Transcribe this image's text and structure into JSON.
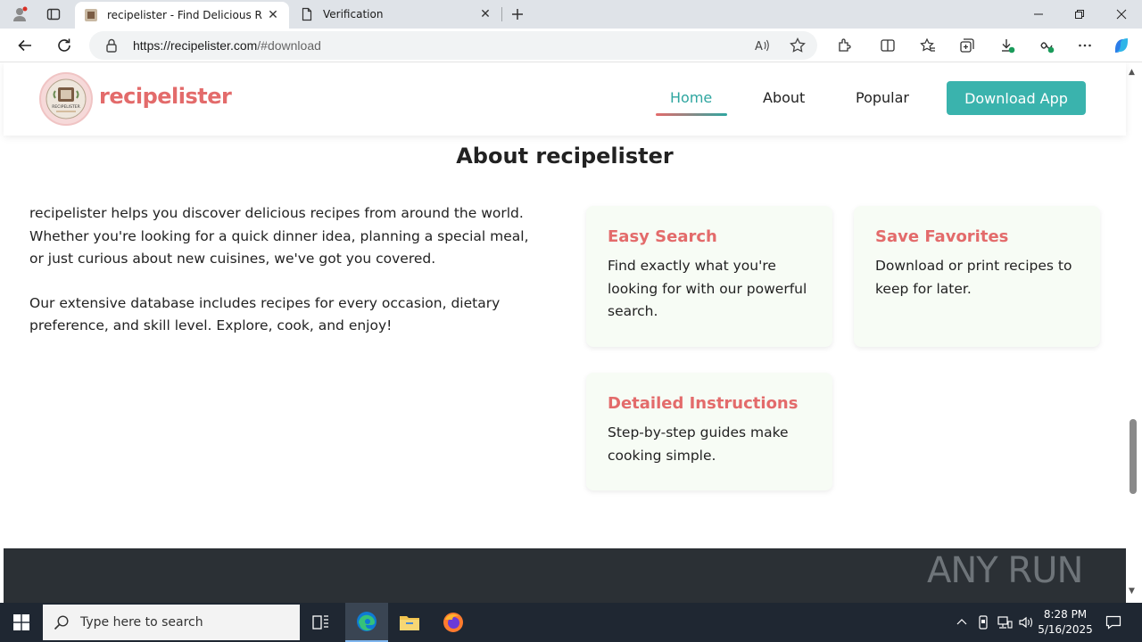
{
  "browser": {
    "tabs": [
      {
        "title": "recipelister - Find Delicious Recip",
        "active": true
      },
      {
        "title": "Verification",
        "active": false
      }
    ],
    "url_host": "https://recipelister.com",
    "url_path": "/#download",
    "icons": [
      "profile-icon",
      "tab-actions-icon",
      "new-tab-icon",
      "minimize-icon",
      "restore-icon",
      "close-window-icon",
      "back-icon",
      "refresh-icon",
      "lock-icon",
      "read-aloud-icon",
      "favorite-star-icon",
      "extensions-icon",
      "split-screen-icon",
      "favorites-icon",
      "collections-icon",
      "downloads-icon",
      "browser-essentials-icon",
      "more-icon",
      "copilot-icon"
    ]
  },
  "site": {
    "brand": "recipelister",
    "logo_text": "RECIPELISTER",
    "nav": {
      "home": "Home",
      "about": "About",
      "popular": "Popular",
      "download": "Download App"
    },
    "about": {
      "title": "About recipelister",
      "paragraph1": "recipelister helps you discover delicious recipes from around the world. Whether you're looking for a quick dinner idea, planning a special meal, or just curious about new cuisines, we've got you covered.",
      "paragraph2": "Our extensive database includes recipes for every occasion, dietary preference, and skill level. Explore, cook, and enjoy!"
    },
    "features": [
      {
        "title": "Easy Search",
        "text": "Find exactly what you're looking for with our powerful search."
      },
      {
        "title": "Save Favorites",
        "text": "Download or print recipes to keep for later."
      },
      {
        "title": "Detailed Instructions",
        "text": "Step-by-step guides make cooking simple."
      }
    ],
    "colors": {
      "accent": "#e36b6b",
      "teal": "#3ab3ad",
      "card_bg": "#f7fcf5",
      "footer": "#2b3035"
    }
  },
  "watermark": "ANY RUN",
  "taskbar": {
    "search_placeholder": "Type here to search",
    "time": "8:28 PM",
    "date": "5/16/2025"
  }
}
